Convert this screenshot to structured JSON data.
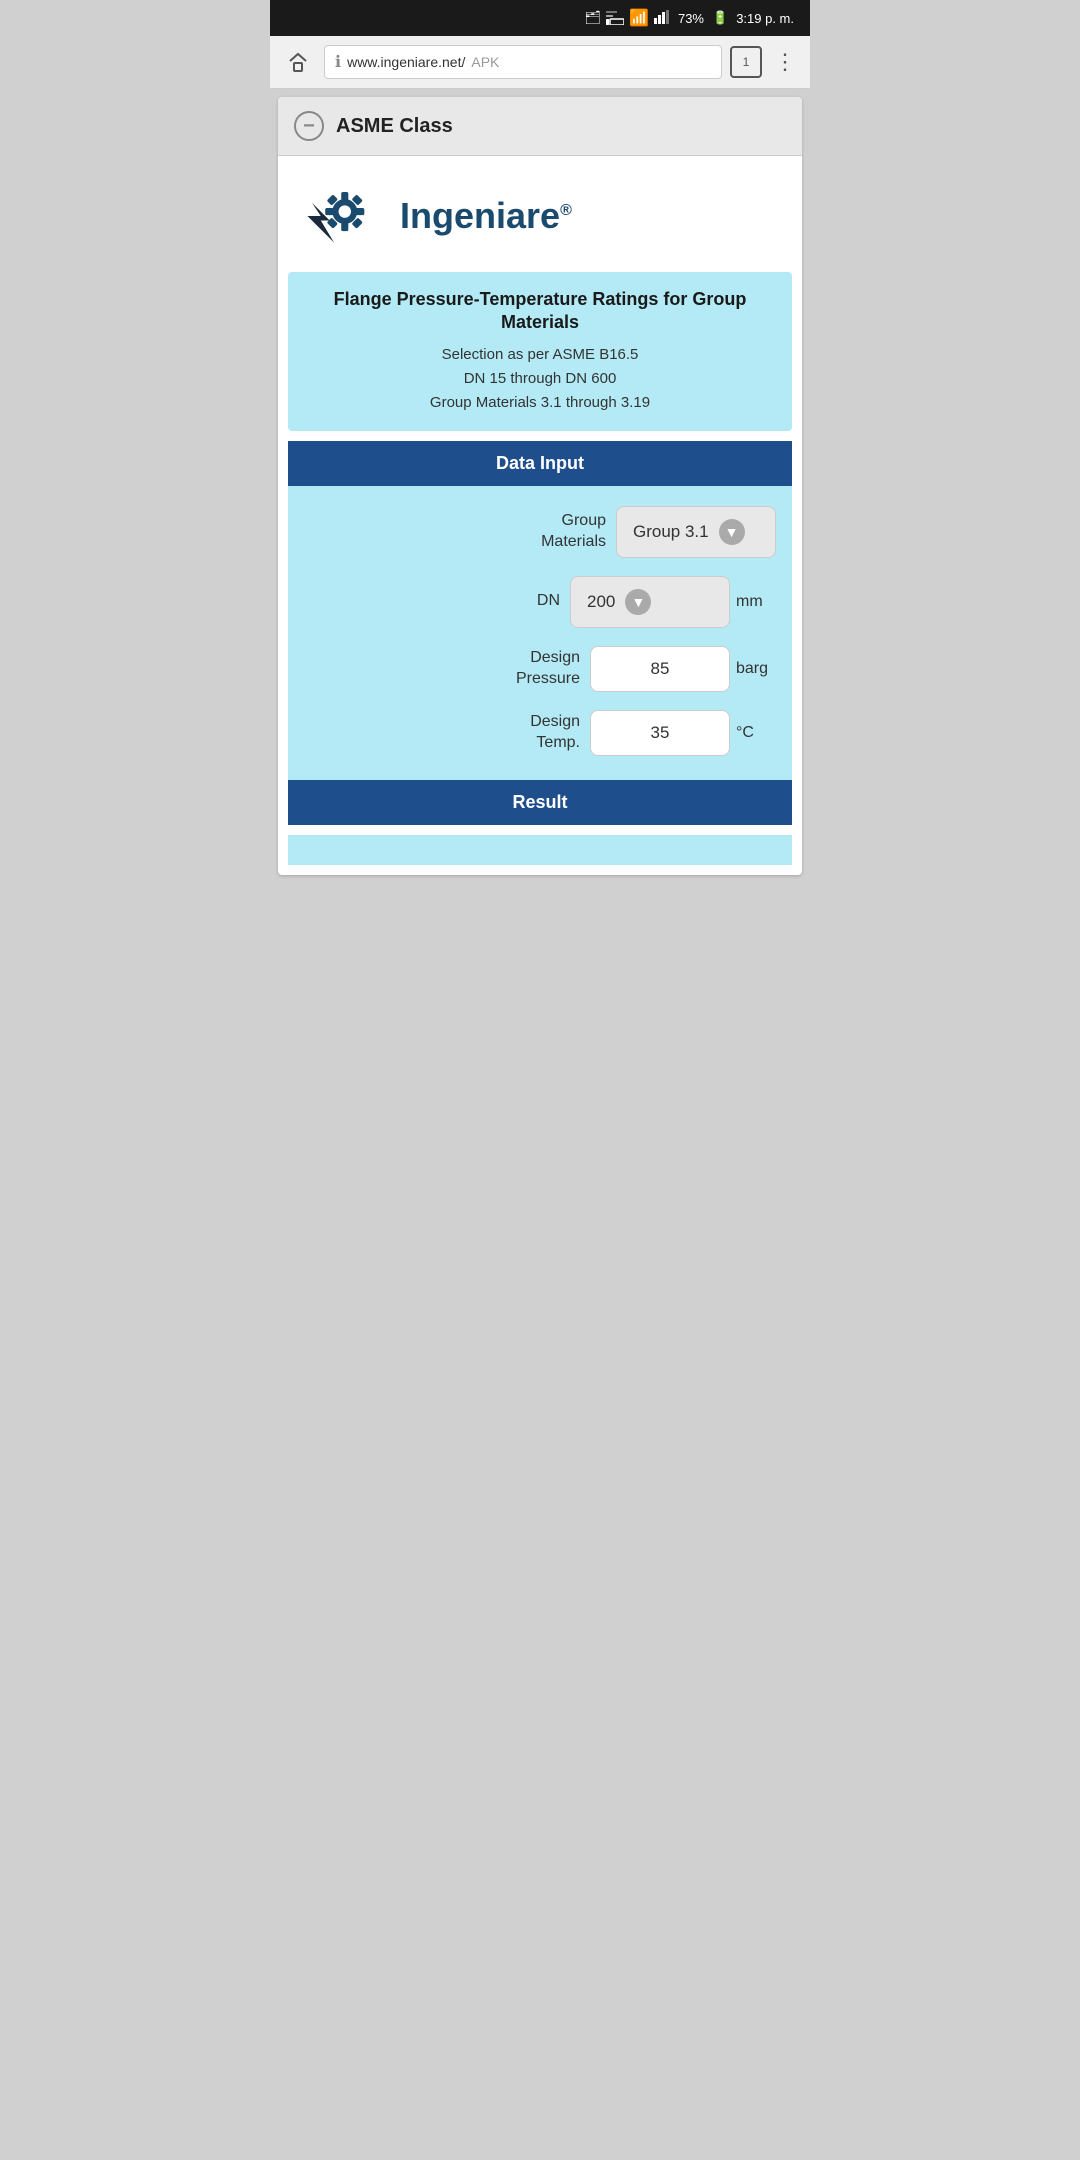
{
  "statusBar": {
    "battery": "73%",
    "time": "3:19 p. m.",
    "icons": [
      "cast",
      "wifi",
      "signal"
    ]
  },
  "browser": {
    "url": "www.ingeniare.net/",
    "urlHighlight": "APK",
    "tabCount": "1"
  },
  "sectionHeader": {
    "title": "ASME Class",
    "collapseIcon": "−"
  },
  "logo": {
    "text": "Ingeniare",
    "regSymbol": "®"
  },
  "infoBox": {
    "title": "Flange Pressure-Temperature Ratings for Group Materials",
    "line1": "Selection as per ASME B16.5",
    "line2": "DN 15 through DN 600",
    "line3": "Group Materials 3.1 through 3.19"
  },
  "dataInput": {
    "sectionLabel": "Data Input",
    "fields": [
      {
        "label": "Group\nMaterials",
        "type": "dropdown",
        "value": "Group 3.1",
        "unit": ""
      },
      {
        "label": "DN",
        "type": "dropdown",
        "value": "200",
        "unit": "mm"
      },
      {
        "label": "Design\nPressure",
        "type": "text",
        "value": "85",
        "unit": "barg"
      },
      {
        "label": "Design\nTemp.",
        "type": "text",
        "value": "35",
        "unit": "°C"
      }
    ]
  },
  "result": {
    "sectionLabel": "Result"
  }
}
